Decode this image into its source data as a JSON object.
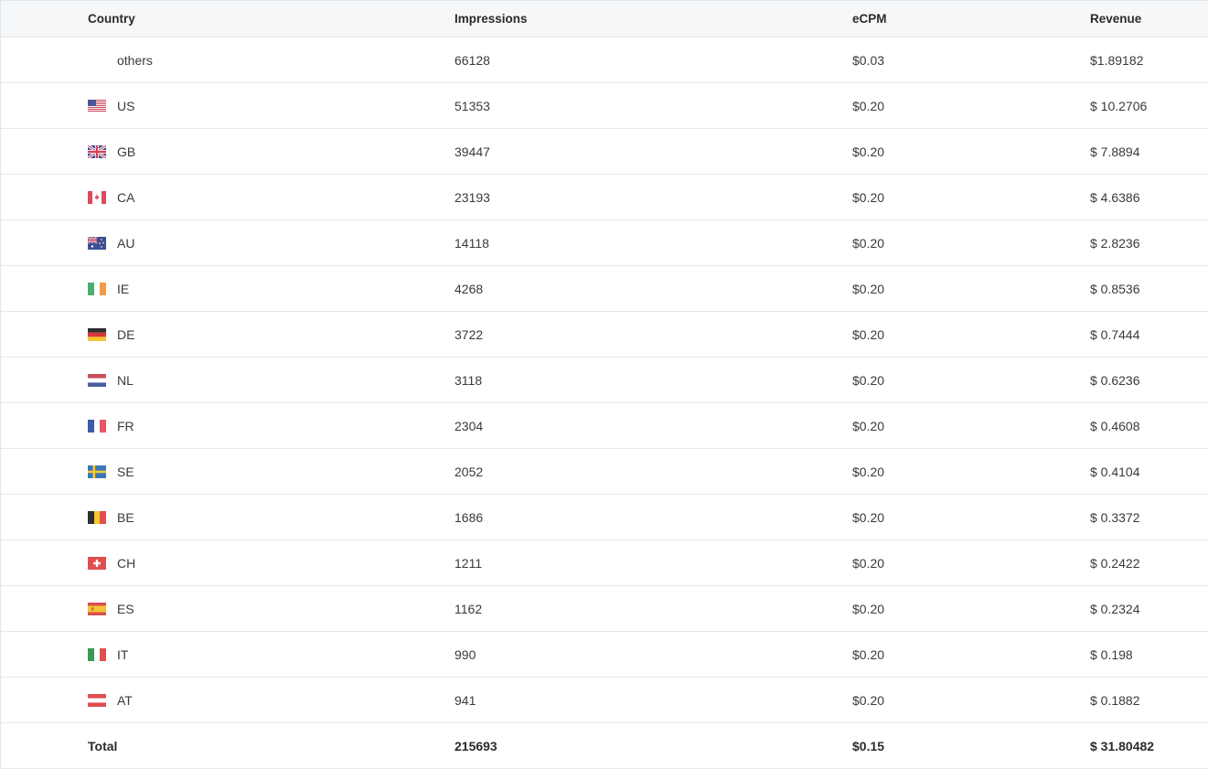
{
  "table": {
    "headers": {
      "country": "Country",
      "impressions": "Impressions",
      "ecpm": "eCPM",
      "revenue": "Revenue"
    },
    "rows": [
      {
        "flag": "none",
        "country": "others",
        "impressions": "66128",
        "ecpm": "$0.03",
        "revenue": "$1.89182"
      },
      {
        "flag": "us-flag-icon",
        "country": "US",
        "impressions": "51353",
        "ecpm": "$0.20",
        "revenue": "$ 10.2706"
      },
      {
        "flag": "gb-flag-icon",
        "country": "GB",
        "impressions": "39447",
        "ecpm": "$0.20",
        "revenue": "$ 7.8894"
      },
      {
        "flag": "ca-flag-icon",
        "country": "CA",
        "impressions": "23193",
        "ecpm": "$0.20",
        "revenue": "$ 4.6386"
      },
      {
        "flag": "au-flag-icon",
        "country": "AU",
        "impressions": "14118",
        "ecpm": "$0.20",
        "revenue": "$ 2.8236"
      },
      {
        "flag": "ie-flag-icon",
        "country": "IE",
        "impressions": "4268",
        "ecpm": "$0.20",
        "revenue": "$ 0.8536"
      },
      {
        "flag": "de-flag-icon",
        "country": "DE",
        "impressions": "3722",
        "ecpm": "$0.20",
        "revenue": "$ 0.7444"
      },
      {
        "flag": "nl-flag-icon",
        "country": "NL",
        "impressions": "3118",
        "ecpm": "$0.20",
        "revenue": "$ 0.6236"
      },
      {
        "flag": "fr-flag-icon",
        "country": "FR",
        "impressions": "2304",
        "ecpm": "$0.20",
        "revenue": "$ 0.4608"
      },
      {
        "flag": "se-flag-icon",
        "country": "SE",
        "impressions": "2052",
        "ecpm": "$0.20",
        "revenue": "$ 0.4104"
      },
      {
        "flag": "be-flag-icon",
        "country": "BE",
        "impressions": "1686",
        "ecpm": "$0.20",
        "revenue": "$ 0.3372"
      },
      {
        "flag": "ch-flag-icon",
        "country": "CH",
        "impressions": "1211",
        "ecpm": "$0.20",
        "revenue": "$ 0.2422"
      },
      {
        "flag": "es-flag-icon",
        "country": "ES",
        "impressions": "1162",
        "ecpm": "$0.20",
        "revenue": "$ 0.2324"
      },
      {
        "flag": "it-flag-icon",
        "country": "IT",
        "impressions": "990",
        "ecpm": "$0.20",
        "revenue": "$ 0.198"
      },
      {
        "flag": "at-flag-icon",
        "country": "AT",
        "impressions": "941",
        "ecpm": "$0.20",
        "revenue": "$ 0.1882"
      }
    ],
    "total": {
      "label": "Total",
      "impressions": "215693",
      "ecpm": "$0.15",
      "revenue": "$ 31.80482"
    }
  },
  "colors": {
    "header_bg": "#f6f7f9",
    "row_border": "#e6e9ec",
    "text": "#3a3a3a"
  }
}
